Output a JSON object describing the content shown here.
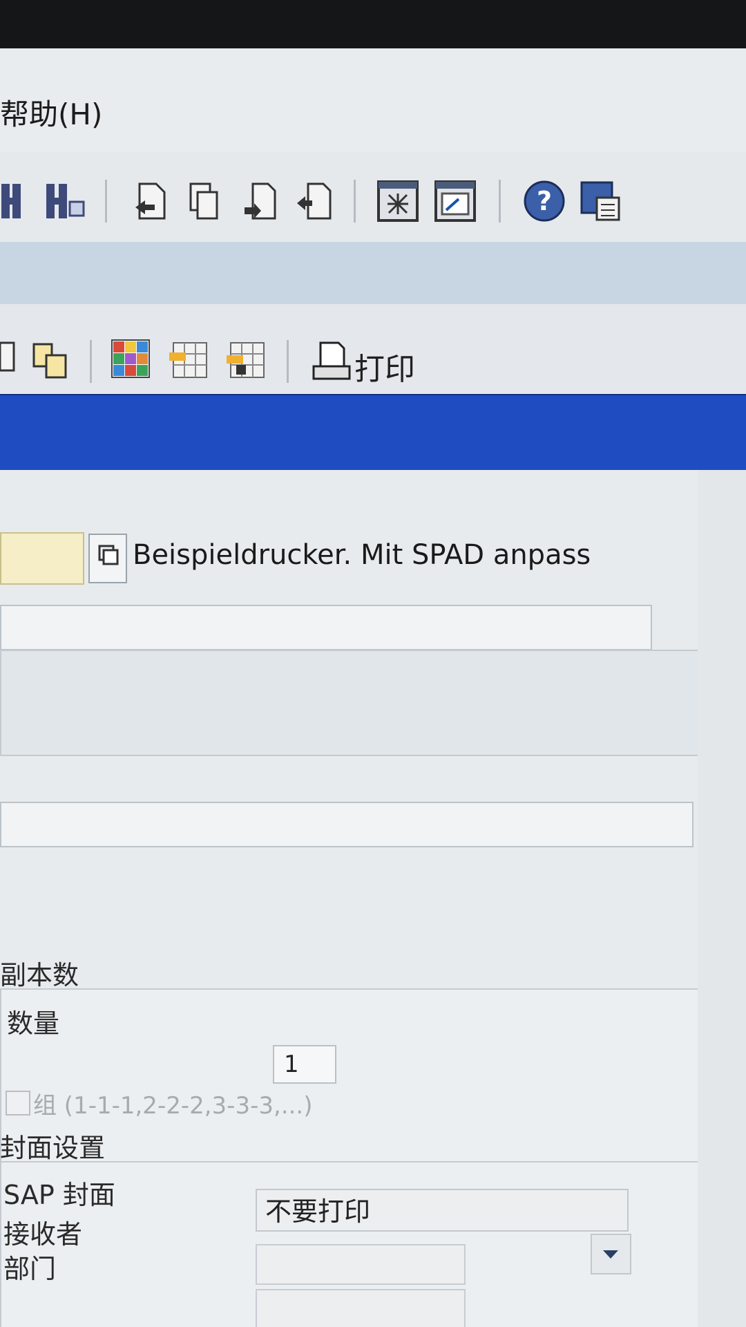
{
  "menubar": {
    "help_label": "帮助(H)"
  },
  "system_toolbar": {
    "icons": [
      "first-page-icon",
      "last-page-icon",
      "create-session-icon",
      "copy-icon",
      "paste-icon",
      "download-icon",
      "layout-icon",
      "shortcut-icon",
      "help-icon",
      "settings-icon"
    ]
  },
  "app_toolbar": {
    "icons": [
      "filter-icon",
      "details-icon",
      "color-grid-icon",
      "insert-row-icon",
      "delete-row-icon",
      "printer-icon"
    ],
    "print_label": "打印"
  },
  "printer": {
    "description": "Beispieldrucker. Mit SPAD anpass"
  },
  "copies": {
    "section_title": "副本数",
    "quantity_label": "数量",
    "quantity_value": "1",
    "group_label": "组 (1-1-1,2-2-2,3-3-3,...)"
  },
  "cover": {
    "section_title": "封面设置",
    "sap_cover_label": "SAP 封面",
    "recipient_label": "接收者",
    "department_label": "部门",
    "sap_cover_value": "不要打印"
  },
  "colors": {
    "title_bar": "#1f4cc0",
    "input_required": "#f5eec7"
  }
}
